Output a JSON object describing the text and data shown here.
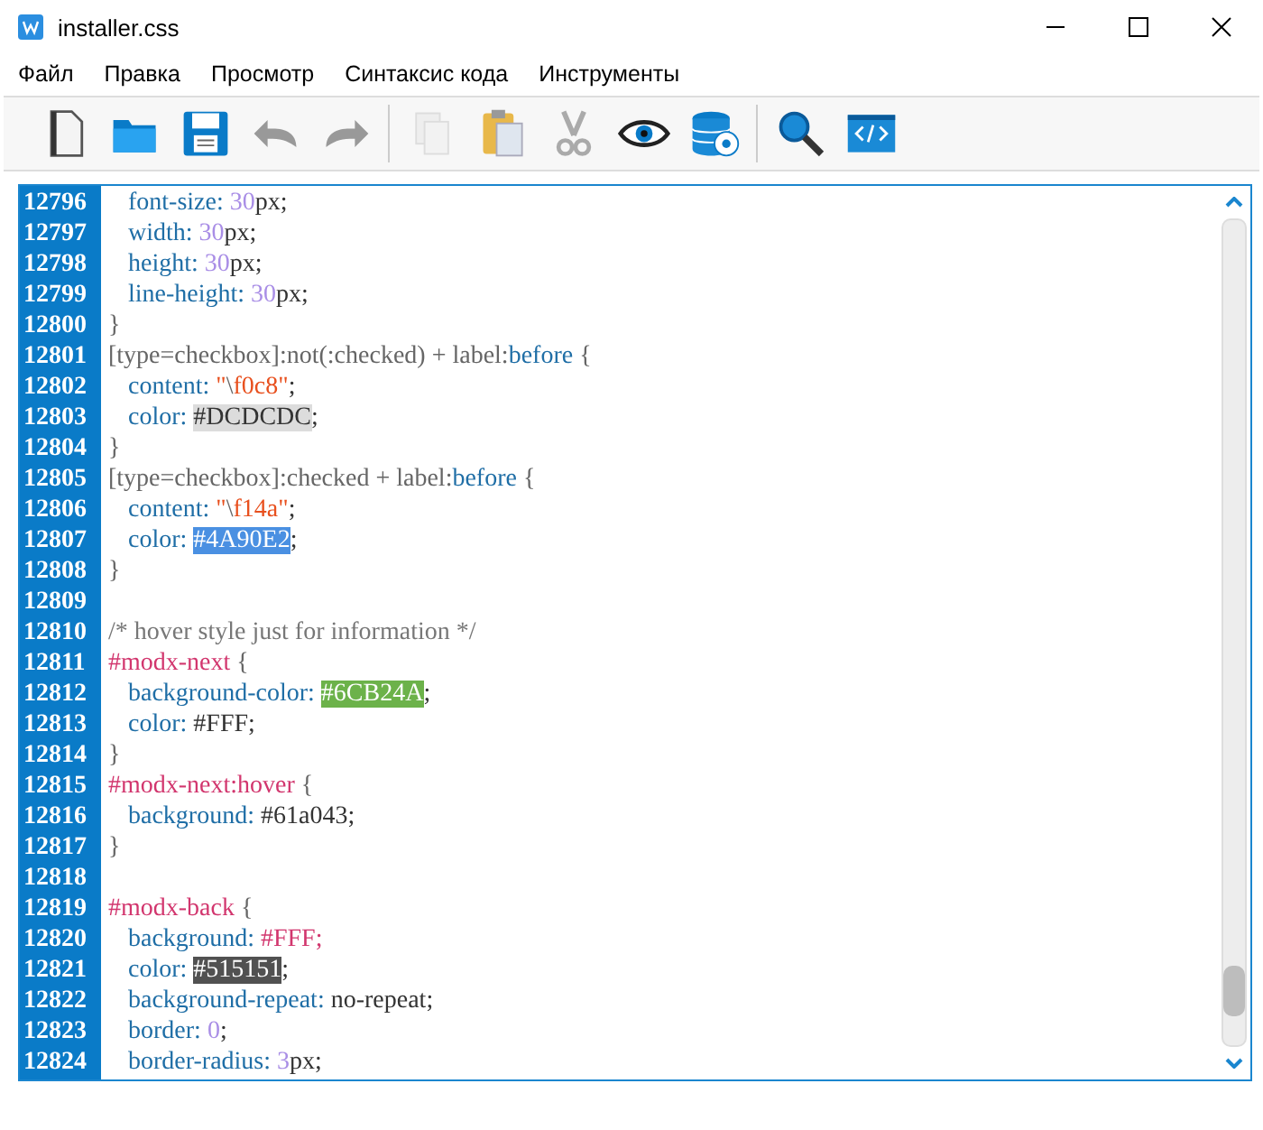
{
  "window": {
    "title": "installer.css"
  },
  "menu": [
    "Файл",
    "Правка",
    "Просмотр",
    "Синтаксис кода",
    "Инструменты"
  ],
  "lines": [
    {
      "number": "12796",
      "kind": "decl",
      "tokens": [
        {
          "text": "font-size: ",
          "kind": "prop"
        },
        {
          "text": "30",
          "kind": "num"
        },
        {
          "text": "px;",
          "kind": "plain"
        }
      ]
    },
    {
      "number": "12797",
      "kind": "decl",
      "tokens": [
        {
          "text": "width: ",
          "kind": "prop"
        },
        {
          "text": "30",
          "kind": "num"
        },
        {
          "text": "px;",
          "kind": "plain"
        }
      ]
    },
    {
      "number": "12798",
      "kind": "decl",
      "tokens": [
        {
          "text": "height: ",
          "kind": "prop"
        },
        {
          "text": "30",
          "kind": "num"
        },
        {
          "text": "px;",
          "kind": "plain"
        }
      ]
    },
    {
      "number": "12799",
      "kind": "decl",
      "tokens": [
        {
          "text": "line-height: ",
          "kind": "prop"
        },
        {
          "text": "30",
          "kind": "num"
        },
        {
          "text": "px;",
          "kind": "plain"
        }
      ]
    },
    {
      "number": "12800",
      "kind": "rule",
      "tokens": [
        {
          "text": "}",
          "kind": "punct"
        }
      ]
    },
    {
      "number": "12801",
      "kind": "rule",
      "tokens": [
        {
          "text": "[type=checkbox]:not(:checked) + label:",
          "kind": "punct"
        },
        {
          "text": "before",
          "kind": "prop"
        },
        {
          "text": " {",
          "kind": "punct"
        }
      ]
    },
    {
      "number": "12802",
      "kind": "decl",
      "tokens": [
        {
          "text": "content: ",
          "kind": "prop"
        },
        {
          "text": "\"",
          "kind": "str"
        },
        {
          "text": "\\",
          "kind": "punct"
        },
        {
          "text": "f0c8\"",
          "kind": "str"
        },
        {
          "text": ";",
          "kind": "plain"
        }
      ]
    },
    {
      "number": "12803",
      "kind": "decl",
      "tokens": [
        {
          "text": "color: ",
          "kind": "prop"
        },
        {
          "text": "#DCDCDC",
          "kind": "swatch",
          "color": "#dcdcdc"
        },
        {
          "text": ";",
          "kind": "plain"
        }
      ]
    },
    {
      "number": "12804",
      "kind": "rule",
      "tokens": [
        {
          "text": "}",
          "kind": "punct"
        }
      ]
    },
    {
      "number": "12805",
      "kind": "rule",
      "tokens": [
        {
          "text": "[type=checkbox]:checked + label:",
          "kind": "punct"
        },
        {
          "text": "before",
          "kind": "prop"
        },
        {
          "text": " {",
          "kind": "punct"
        }
      ]
    },
    {
      "number": "12806",
      "kind": "decl",
      "tokens": [
        {
          "text": "content: ",
          "kind": "prop"
        },
        {
          "text": "\"",
          "kind": "str"
        },
        {
          "text": "\\",
          "kind": "punct"
        },
        {
          "text": "f14a\"",
          "kind": "str"
        },
        {
          "text": ";",
          "kind": "plain"
        }
      ]
    },
    {
      "number": "12807",
      "kind": "decl",
      "tokens": [
        {
          "text": "color: ",
          "kind": "prop"
        },
        {
          "text": "#4A90E2",
          "kind": "swatch",
          "color": "#4a90e2"
        },
        {
          "text": ";",
          "kind": "plain"
        }
      ]
    },
    {
      "number": "12808",
      "kind": "rule",
      "tokens": [
        {
          "text": "}",
          "kind": "punct"
        }
      ]
    },
    {
      "number": "12809"
    },
    {
      "number": "12810",
      "kind": "rule",
      "tokens": [
        {
          "text": "/* hover style just for information */",
          "kind": "comment"
        }
      ]
    },
    {
      "number": "12811",
      "kind": "rule",
      "tokens": [
        {
          "text": "#modx-next",
          "kind": "hash"
        },
        {
          "text": " {",
          "kind": "punct"
        }
      ]
    },
    {
      "number": "12812",
      "kind": "decl",
      "tokens": [
        {
          "text": "background-color: ",
          "kind": "prop"
        },
        {
          "text": "#6CB24A",
          "kind": "swatch",
          "color": "#6cb24a"
        },
        {
          "text": ";",
          "kind": "plain"
        }
      ]
    },
    {
      "number": "12813",
      "kind": "decl",
      "tokens": [
        {
          "text": "color: ",
          "kind": "prop"
        },
        {
          "text": "#FFF;",
          "kind": "plain"
        }
      ]
    },
    {
      "number": "12814",
      "kind": "rule",
      "tokens": [
        {
          "text": "}",
          "kind": "punct"
        }
      ]
    },
    {
      "number": "12815",
      "kind": "rule",
      "tokens": [
        {
          "text": "#modx-next:hover",
          "kind": "hash"
        },
        {
          "text": " {",
          "kind": "punct"
        }
      ]
    },
    {
      "number": "12816",
      "kind": "decl",
      "tokens": [
        {
          "text": "background: ",
          "kind": "prop"
        },
        {
          "text": "#61a043;",
          "kind": "plain"
        }
      ]
    },
    {
      "number": "12817",
      "kind": "rule",
      "tokens": [
        {
          "text": "}",
          "kind": "punct"
        }
      ]
    },
    {
      "number": "12818"
    },
    {
      "number": "12819",
      "kind": "rule",
      "tokens": [
        {
          "text": "#modx-back",
          "kind": "hash"
        },
        {
          "text": " {",
          "kind": "punct"
        }
      ]
    },
    {
      "number": "12820",
      "kind": "decl",
      "tokens": [
        {
          "text": "background: ",
          "kind": "prop"
        },
        {
          "text": "#FFF;",
          "kind": "hash"
        }
      ]
    },
    {
      "number": "12821",
      "kind": "decl",
      "tokens": [
        {
          "text": "color: ",
          "kind": "prop"
        },
        {
          "text": "#515151",
          "kind": "swatch",
          "color": "#515151"
        },
        {
          "text": ";",
          "kind": "plain"
        }
      ]
    },
    {
      "number": "12822",
      "kind": "decl",
      "tokens": [
        {
          "text": "background-repeat: ",
          "kind": "prop"
        },
        {
          "text": "no-repeat;",
          "kind": "plain"
        }
      ]
    },
    {
      "number": "12823",
      "kind": "decl",
      "tokens": [
        {
          "text": "border: ",
          "kind": "prop"
        },
        {
          "text": "0",
          "kind": "num"
        },
        {
          "text": ";",
          "kind": "plain"
        }
      ]
    },
    {
      "number": "12824",
      "kind": "decl",
      "tokens": [
        {
          "text": "border-radius: ",
          "kind": "prop"
        },
        {
          "text": "3",
          "kind": "num"
        },
        {
          "text": "px;",
          "kind": "plain"
        }
      ]
    }
  ]
}
